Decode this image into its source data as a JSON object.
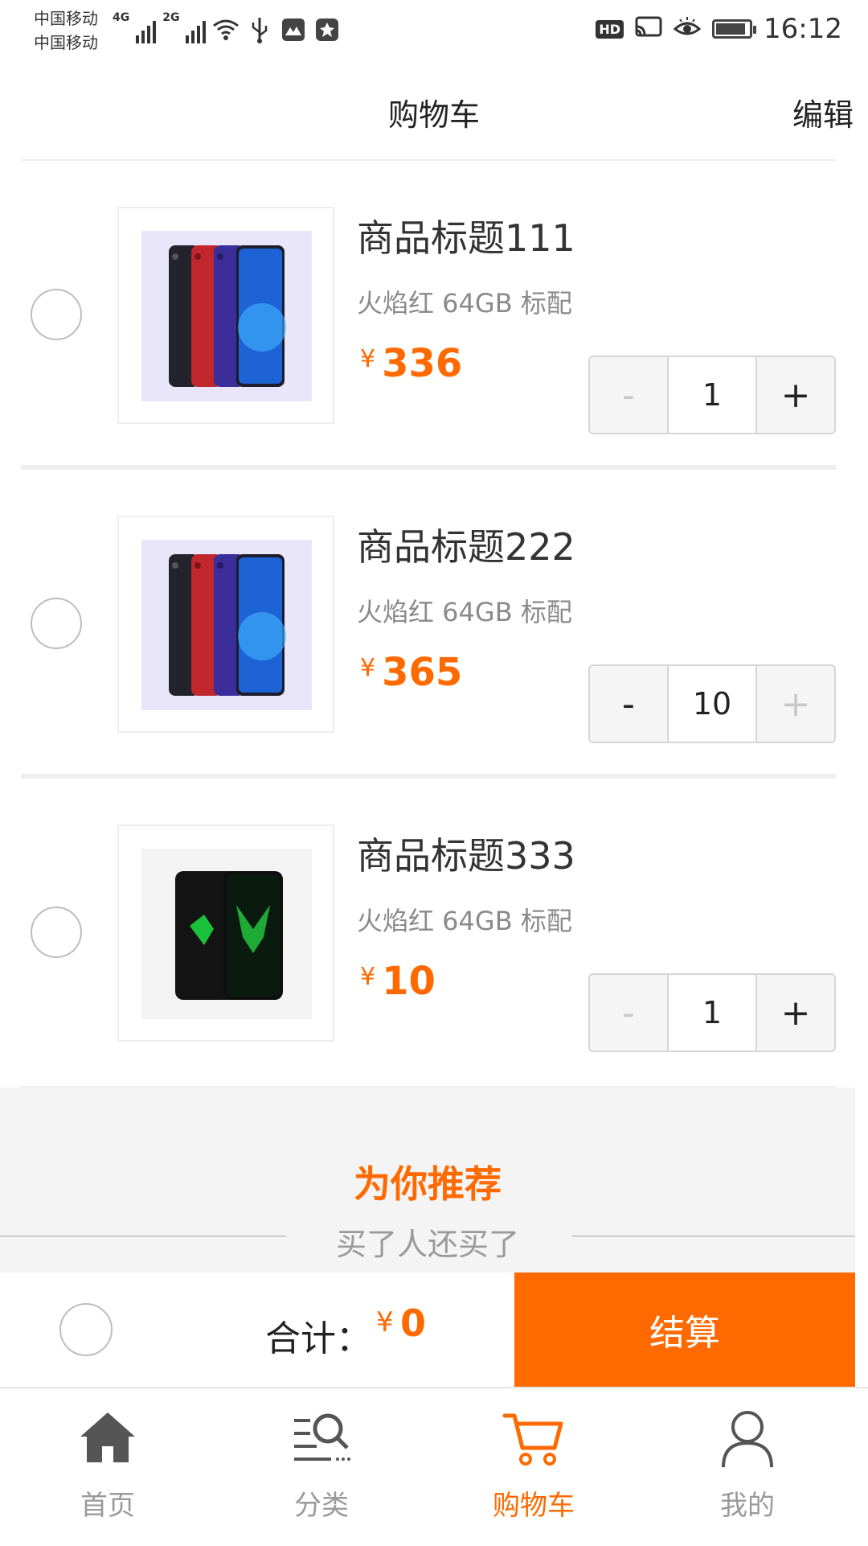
{
  "status_bar": {
    "carrier_1": "中国移动",
    "carrier_2": "中国移动",
    "net_1": "4G",
    "net_2": "2G",
    "hd": "HD",
    "time": "16:12",
    "battery_level": 0.9
  },
  "header": {
    "title": "购物车",
    "edit_label": "编辑"
  },
  "cart_items": [
    {
      "title": "商品标题111",
      "spec": "火焰红 64GB 标配",
      "currency": "¥",
      "price": "336",
      "minus": "-",
      "quantity": "1",
      "plus": "+",
      "minus_disabled": true,
      "plus_disabled": false,
      "image": "phone-lineup-image"
    },
    {
      "title": "商品标题222",
      "spec": "火焰红 64GB 标配",
      "currency": "¥",
      "price": "365",
      "minus": "-",
      "quantity": "10",
      "plus": "+",
      "minus_disabled": false,
      "plus_disabled": true,
      "image": "phone-lineup-image"
    },
    {
      "title": "商品标题333",
      "spec": "火焰红 64GB 标配",
      "currency": "¥",
      "price": "10",
      "minus": "-",
      "quantity": "1",
      "plus": "+",
      "minus_disabled": true,
      "plus_disabled": false,
      "image": "gaming-phone-image"
    }
  ],
  "recommend": {
    "title": "为你推荐",
    "subtitle": "买了人还买了"
  },
  "checkout": {
    "total_label": "合计：",
    "currency": "¥",
    "total_value": "0",
    "settle_label": "结算"
  },
  "tabbar": {
    "items": [
      {
        "label": "首页",
        "icon": "home-icon",
        "active": false
      },
      {
        "label": "分类",
        "icon": "category-search-icon",
        "active": false
      },
      {
        "label": "购物车",
        "icon": "cart-icon",
        "active": true
      },
      {
        "label": "我的",
        "icon": "user-icon",
        "active": false
      }
    ]
  },
  "colors": {
    "accent": "#ff6a00",
    "muted": "#9a9a9a",
    "divider": "#eeeeee"
  }
}
